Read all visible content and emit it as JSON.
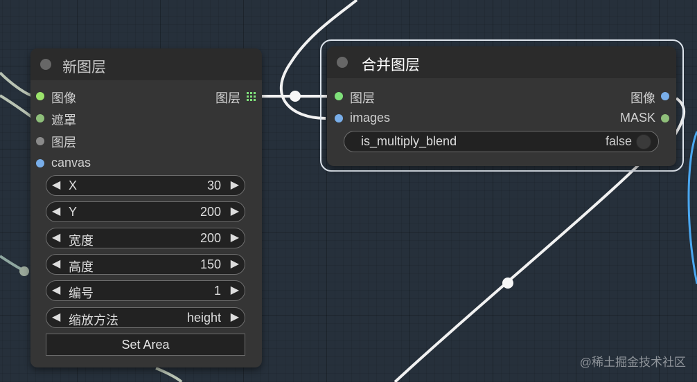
{
  "node_new_layer": {
    "title": "新图层",
    "inputs": [
      {
        "label": "图像",
        "color": "#9be36b"
      },
      {
        "label": "遮罩",
        "color": "#8fbf7a"
      },
      {
        "label": "图层",
        "color": "#8a8a8a"
      },
      {
        "label": "canvas",
        "color": "#79aee9"
      }
    ],
    "output": {
      "label": "图层",
      "color": "#7fe07a"
    },
    "widgets": [
      {
        "label": "X",
        "value": "30"
      },
      {
        "label": "Y",
        "value": "200"
      },
      {
        "label": "宽度",
        "value": "200"
      },
      {
        "label": "高度",
        "value": "150"
      },
      {
        "label": "编号",
        "value": "1"
      },
      {
        "label": "缩放方法",
        "value": "height"
      }
    ],
    "button": "Set Area"
  },
  "node_merge_layer": {
    "title": "合并图层",
    "inputs": [
      {
        "label": "图层",
        "color": "#7fe07a"
      },
      {
        "label": "images",
        "color": "#79aee9"
      }
    ],
    "outputs": [
      {
        "label": "图像",
        "color": "#79aee9"
      },
      {
        "label": "MASK",
        "color": "#8fbf7a"
      }
    ],
    "toggle": {
      "label": "is_multiply_blend",
      "value": "false"
    }
  },
  "watermark": "@稀土掘金技术社区",
  "icons": {
    "left_arrow": "◀",
    "right_arrow": "▶",
    "grid_slot": "grid-slot-icon"
  }
}
